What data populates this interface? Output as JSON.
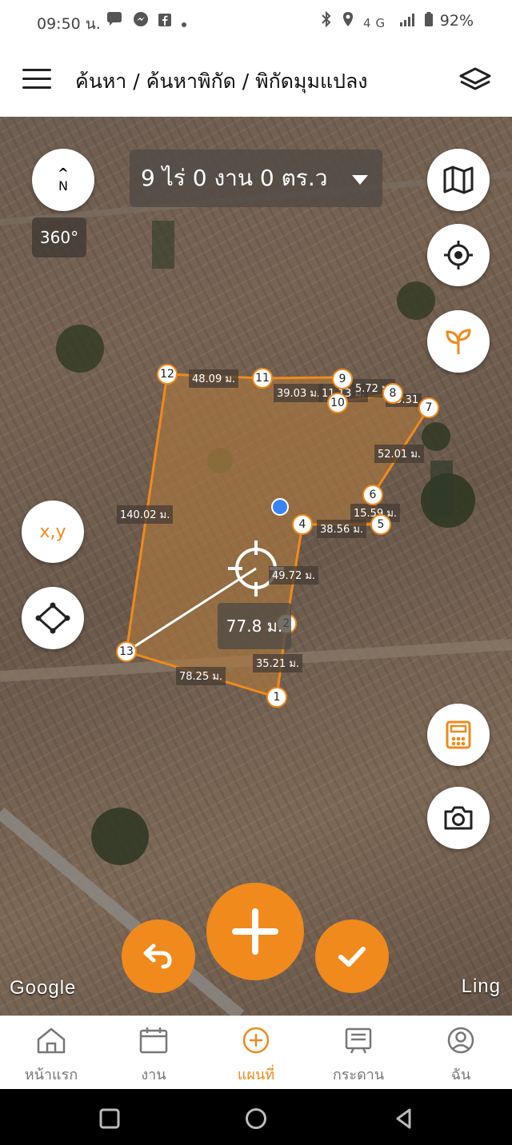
{
  "status_bar": {
    "time": "09:50 น.",
    "left_icons": "chat, messenger, facebook, dot",
    "network": "4G",
    "battery": "92%"
  },
  "header": {
    "breadcrumb": "ค้นหา / ค้นหาพิกัด / พิกัดมุมแปลง",
    "menu_icon": "hamburger-icon",
    "layers_icon": "layers-icon"
  },
  "map": {
    "compass": {
      "arrow": "^",
      "letter": "N",
      "rotation_label": "360°"
    },
    "area_text": "9 ไร่ 0 งาน 0 ตร.ว",
    "xy_button_label": "x,y",
    "measure_distance": "77.8 ม.",
    "vertices": [
      "1",
      "2",
      "4",
      "5",
      "6",
      "7",
      "8",
      "9",
      "10",
      "11",
      "12",
      "13"
    ],
    "segment_labels": [
      "48.09 ม.",
      "39.03 ม.",
      "11.13 ม.",
      "5.72 ม.",
      "19.31",
      "52.01 ม.",
      "15.59 ม.",
      "38.56 ม.",
      "49.72 ม.",
      "35.21 ม.",
      "78.25 ม.",
      "140.02 ม."
    ],
    "attribution_left": "Google",
    "attribution_right": "Ling",
    "accent_color": "#f08a1c",
    "polygon_color": "#f08a1c"
  },
  "bottom_nav": [
    {
      "label": "หน้าแรก",
      "icon": "home-icon"
    },
    {
      "label": "งาน",
      "icon": "calendar-icon"
    },
    {
      "label": "แผนที่",
      "icon": "plus-circle-icon",
      "active": true
    },
    {
      "label": "กระดาน",
      "icon": "board-icon"
    },
    {
      "label": "ฉัน",
      "icon": "user-icon"
    }
  ]
}
